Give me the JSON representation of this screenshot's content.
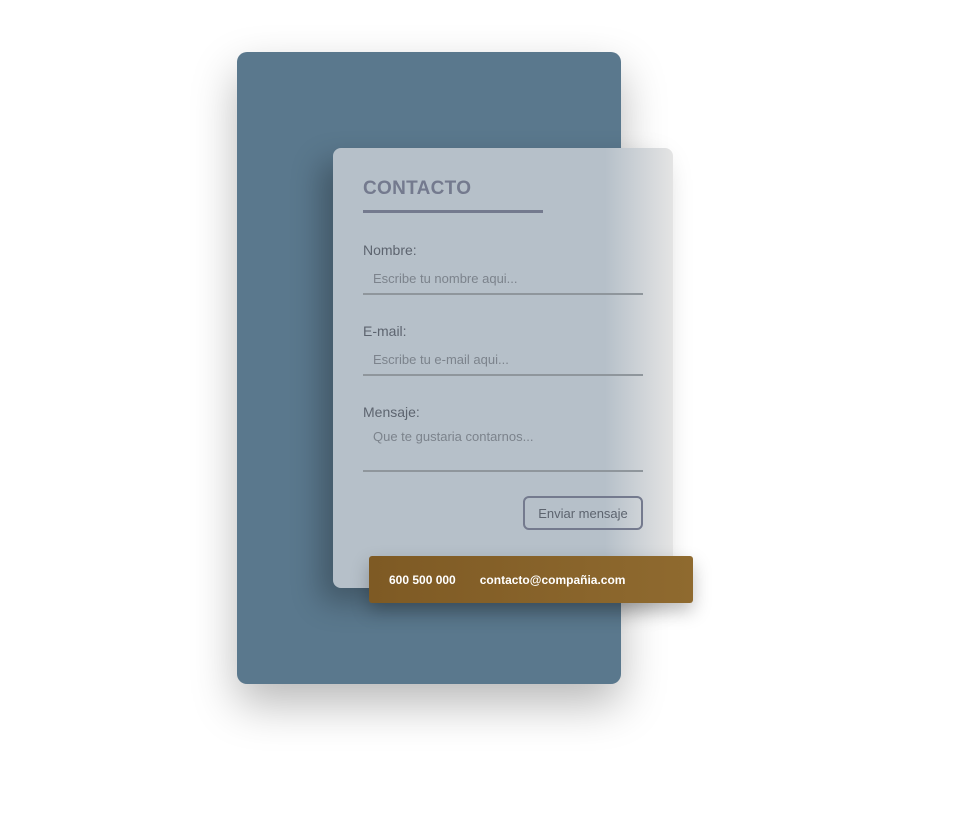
{
  "form": {
    "title": "CONTACTO",
    "fields": {
      "name": {
        "label": "Nombre:",
        "placeholder": "Escribe tu nombre aqui..."
      },
      "email": {
        "label": "E-mail:",
        "placeholder": "Escribe tu e-mail aqui..."
      },
      "message": {
        "label": "Mensaje:",
        "placeholder": "Que te gustaria contarnos..."
      }
    },
    "submit_label": "Enviar mensaje"
  },
  "contact_info": {
    "phone": "600 500 000",
    "email": "contacto@compañia.com"
  },
  "colors": {
    "back_panel": "#5a788d",
    "card": "#b6c0c9",
    "accent": "#747a8e",
    "contact_bar": "#8a6429"
  }
}
